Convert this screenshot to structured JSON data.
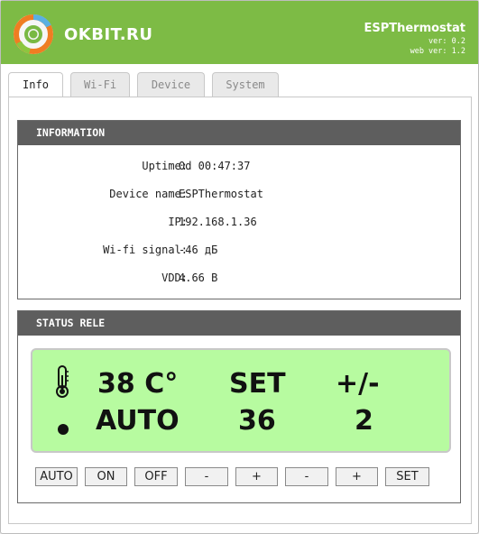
{
  "header": {
    "brand": "OKBIT.RU",
    "app_name": "ESPThermostat",
    "version": "ver: 0.2",
    "web_version": "web ver: 1.2",
    "logo_icon": "okbit-ring-logo"
  },
  "tabs": [
    {
      "label": "Info",
      "active": true
    },
    {
      "label": "Wi-Fi",
      "active": false
    },
    {
      "label": "Device",
      "active": false
    },
    {
      "label": "System",
      "active": false
    }
  ],
  "information": {
    "title": "INFORMATION",
    "rows": [
      {
        "label": "Uptime:",
        "value": "0d 00:47:37"
      },
      {
        "label": "Device name:",
        "value": "ESPThermostat"
      },
      {
        "label": "IP:",
        "value": "192.168.1.36"
      },
      {
        "label": "Wi-fi signal:",
        "value": "-46 дБ"
      },
      {
        "label": "VDD:",
        "value": "4.66 В"
      }
    ]
  },
  "status": {
    "title": "STATUS RELE",
    "lcd": {
      "temperature": "38 C°",
      "set_label": "SET",
      "hyst_label": "+/-",
      "mode": "AUTO",
      "set_value": "36",
      "hyst_value": "2",
      "thermometer_icon": "thermometer-icon",
      "relay_indicator_icon": "relay-status-dot"
    },
    "buttons": [
      "AUTO",
      "ON",
      "OFF",
      "-",
      "+",
      "-",
      "+",
      "SET"
    ]
  },
  "colors": {
    "header": "#7dbb45",
    "card_title": "#5e5e5e",
    "lcd_background": "#b7fba0"
  }
}
